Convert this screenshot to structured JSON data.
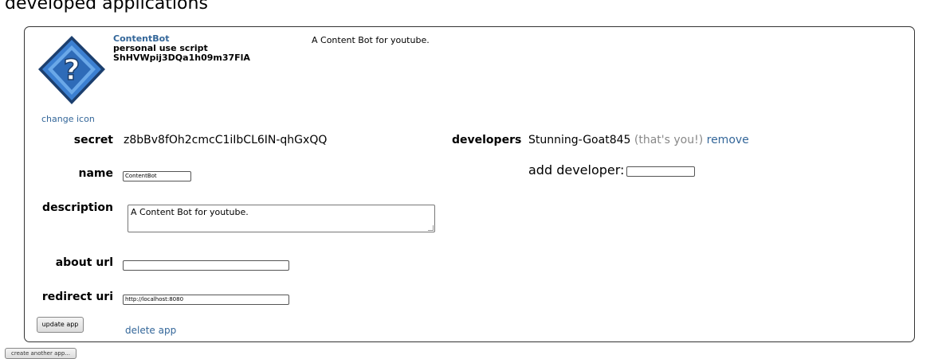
{
  "page": {
    "heading": "developed applications"
  },
  "app": {
    "name": "ContentBot",
    "type": "personal use script",
    "client_id": "ShHVWpij3DQa1h09m37FlA",
    "summary_description": "A Content Bot for youtube.",
    "change_icon_label": "change icon",
    "fields": {
      "secret_label": "secret",
      "secret_value": "z8bBv8fOh2cmcC1iIbCL6IN-qhGxQQ",
      "name_label": "name",
      "name_value": "ContentBot",
      "description_label": "description",
      "description_value": "A Content Bot for youtube.",
      "about_url_label": "about url",
      "about_url_value": "",
      "redirect_uri_label": "redirect uri",
      "redirect_uri_value": "http://localhost:8080"
    },
    "developers": {
      "label": "developers",
      "name": "Stunning-Goat845",
      "you_note": "(that's you!)",
      "remove_label": "remove",
      "add_label": "add developer:"
    },
    "update_button_label": "update app",
    "delete_label": "delete app"
  },
  "footer": {
    "create_button_label": "create another app..."
  },
  "colors": {
    "link": "#336699",
    "icon_blue": "#3b7fd1",
    "muted": "#888888"
  },
  "icons": {
    "app_icon": "question-mark-diamond-icon"
  }
}
